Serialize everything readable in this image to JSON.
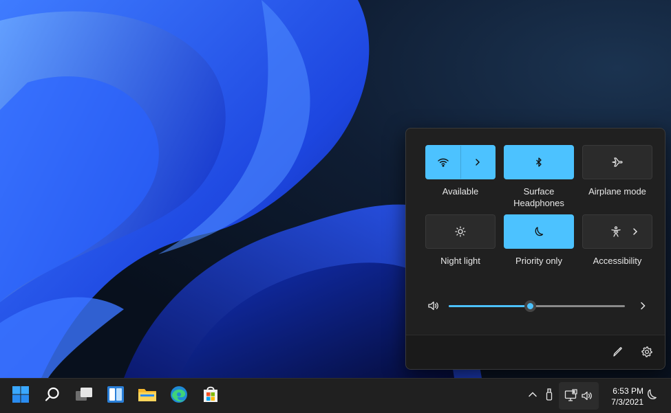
{
  "quick_settings": {
    "tiles": [
      {
        "label": "Available",
        "icon": "wifi-icon",
        "on": true,
        "has_arrow": true
      },
      {
        "label": "Surface Headphones",
        "icon": "bluetooth-icon",
        "on": true,
        "has_arrow": false
      },
      {
        "label": "Airplane mode",
        "icon": "airplane-icon",
        "on": false,
        "has_arrow": false
      },
      {
        "label": "Night light",
        "icon": "brightness-icon",
        "on": false,
        "has_arrow": false
      },
      {
        "label": "Priority only",
        "icon": "moon-icon",
        "on": true,
        "has_arrow": false
      },
      {
        "label": "Accessibility",
        "icon": "accessibility-icon",
        "on": false,
        "has_arrow": true
      }
    ],
    "volume": {
      "level_percent": 46,
      "icon": "speaker-icon",
      "more_icon": "chevron-right-icon"
    },
    "footer": {
      "edit_icon": "pencil-icon",
      "settings_icon": "gear-icon"
    }
  },
  "taskbar": {
    "apps": [
      "windows-start-icon",
      "search-icon",
      "task-view-icon",
      "widgets-icon",
      "file-explorer-icon",
      "edge-icon",
      "store-icon"
    ],
    "tray": [
      "chevron-up-icon",
      "usb-icon",
      "network-icon",
      "speaker-icon",
      "moon-icon"
    ],
    "clock": {
      "time": "6:53 PM",
      "date": "7/3/2021"
    }
  },
  "colors": {
    "accent": "#4cc2ff",
    "panel": "#202020",
    "tile_off": "#2b2b2b"
  }
}
